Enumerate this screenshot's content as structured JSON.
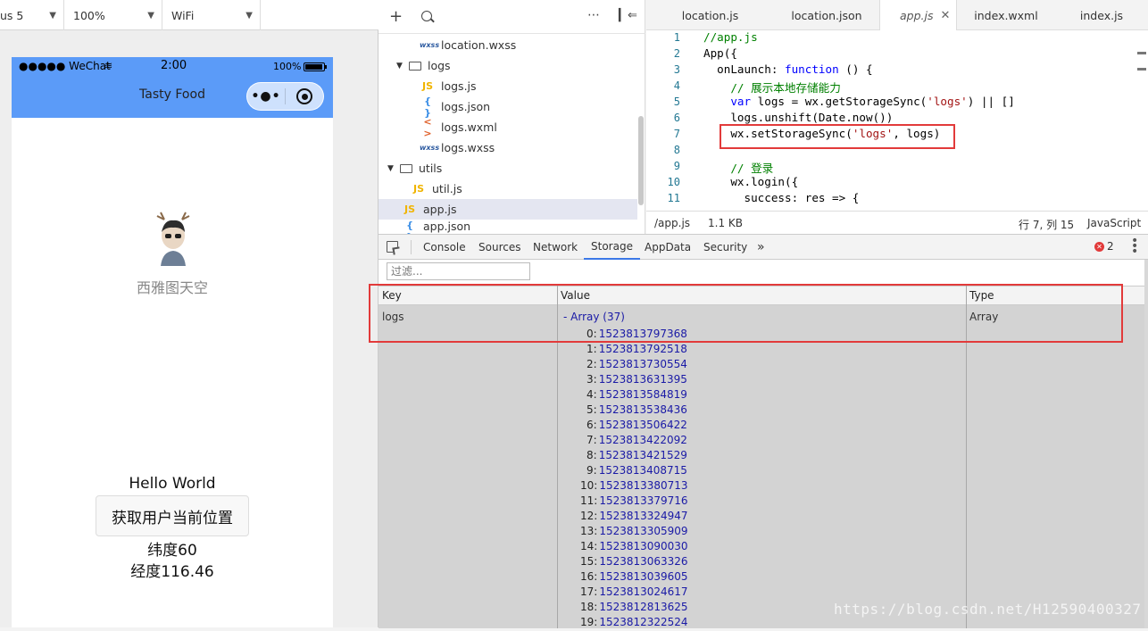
{
  "simulator": {
    "device": "us 5",
    "zoom": "100%",
    "network": "WiFi",
    "status_bar": {
      "carrier": "●●●●● WeChat",
      "time": "2:00",
      "battery": "100%"
    },
    "nav_title": "Tasty Food",
    "username": "西雅图天空",
    "hello": "Hello World",
    "location_button": "获取用户当前位置",
    "latitude": "纬度60",
    "longitude": "经度116.46"
  },
  "file_tree": {
    "items": [
      {
        "label": "location.wxss",
        "type": "wxss",
        "type_label": "wxss"
      },
      {
        "label": "logs",
        "type": "folder"
      },
      {
        "label": "logs.js",
        "type": "js",
        "type_label": "JS"
      },
      {
        "label": "logs.json",
        "type": "json",
        "type_label": "{ }"
      },
      {
        "label": "logs.wxml",
        "type": "wxml",
        "type_label": "< >"
      },
      {
        "label": "logs.wxss",
        "type": "wxss",
        "type_label": "wxss"
      },
      {
        "label": "utils",
        "type": "folder"
      },
      {
        "label": "util.js",
        "type": "js",
        "type_label": "JS"
      },
      {
        "label": "app.js",
        "type": "js",
        "type_label": "JS",
        "selected": true
      },
      {
        "label": "app.json",
        "type": "json",
        "type_label": "{ }"
      }
    ]
  },
  "editor": {
    "tabs": [
      {
        "label": "location.js"
      },
      {
        "label": "location.json"
      },
      {
        "label": "app.js",
        "active": true
      },
      {
        "label": "index.wxml"
      },
      {
        "label": "index.js"
      }
    ],
    "line_numbers": [
      "1",
      "2",
      "3",
      "4",
      "5",
      "6",
      "7",
      "8",
      "9",
      "10",
      "11"
    ],
    "code": {
      "l1": "//app.js",
      "l2": "App({",
      "l3a": "  onLaunch: ",
      "l3b": "function",
      "l3c": " () {",
      "l4": "    // 展示本地存储能力",
      "l5a": "    ",
      "l5b": "var",
      "l5c": " logs = wx.getStorageSync(",
      "l5d": "'logs'",
      "l5e": ") || []",
      "l6": "    logs.unshift(Date.now())",
      "l7a": "    wx.setStorageSync(",
      "l7b": "'logs'",
      "l7c": ", logs)",
      "l9": "    // 登录",
      "l10": "    wx.login({",
      "l11": "      success: res => {"
    },
    "status": {
      "path": "/app.js",
      "size": "1.1 KB",
      "cursor": "行 7, 列 15",
      "language": "JavaScript"
    }
  },
  "devtools": {
    "tabs": [
      "Console",
      "Sources",
      "Network",
      "Storage",
      "AppData",
      "Security"
    ],
    "active_tab": "Storage",
    "more": "»",
    "error_count": "2",
    "filter_placeholder": "过滤...",
    "columns": {
      "key": "Key",
      "value": "Value",
      "type": "Type"
    },
    "row": {
      "key": "logs",
      "value_summary": "-  Array (37)",
      "type": "Array",
      "items": [
        {
          "index": "0:",
          "value": "1523813797368"
        },
        {
          "index": "1:",
          "value": "1523813792518"
        },
        {
          "index": "2:",
          "value": "1523813730554"
        },
        {
          "index": "3:",
          "value": "1523813631395"
        },
        {
          "index": "4:",
          "value": "1523813584819"
        },
        {
          "index": "5:",
          "value": "1523813538436"
        },
        {
          "index": "6:",
          "value": "1523813506422"
        },
        {
          "index": "7:",
          "value": "1523813422092"
        },
        {
          "index": "8:",
          "value": "1523813421529"
        },
        {
          "index": "9:",
          "value": "1523813408715"
        },
        {
          "index": "10:",
          "value": "1523813380713"
        },
        {
          "index": "11:",
          "value": "1523813379716"
        },
        {
          "index": "12:",
          "value": "1523813324947"
        },
        {
          "index": "13:",
          "value": "1523813305909"
        },
        {
          "index": "14:",
          "value": "1523813090030"
        },
        {
          "index": "15:",
          "value": "1523813063326"
        },
        {
          "index": "16:",
          "value": "1523813039605"
        },
        {
          "index": "17:",
          "value": "1523813024617"
        },
        {
          "index": "18:",
          "value": "1523812813625"
        },
        {
          "index": "19:",
          "value": "1523812322524"
        }
      ]
    }
  },
  "watermark": "https://blog.csdn.net/H12590400327",
  "colors": {
    "navbar": "#5b9bf8",
    "highlight_box": "#e23a3a",
    "array_value": "#1a1aa6"
  }
}
